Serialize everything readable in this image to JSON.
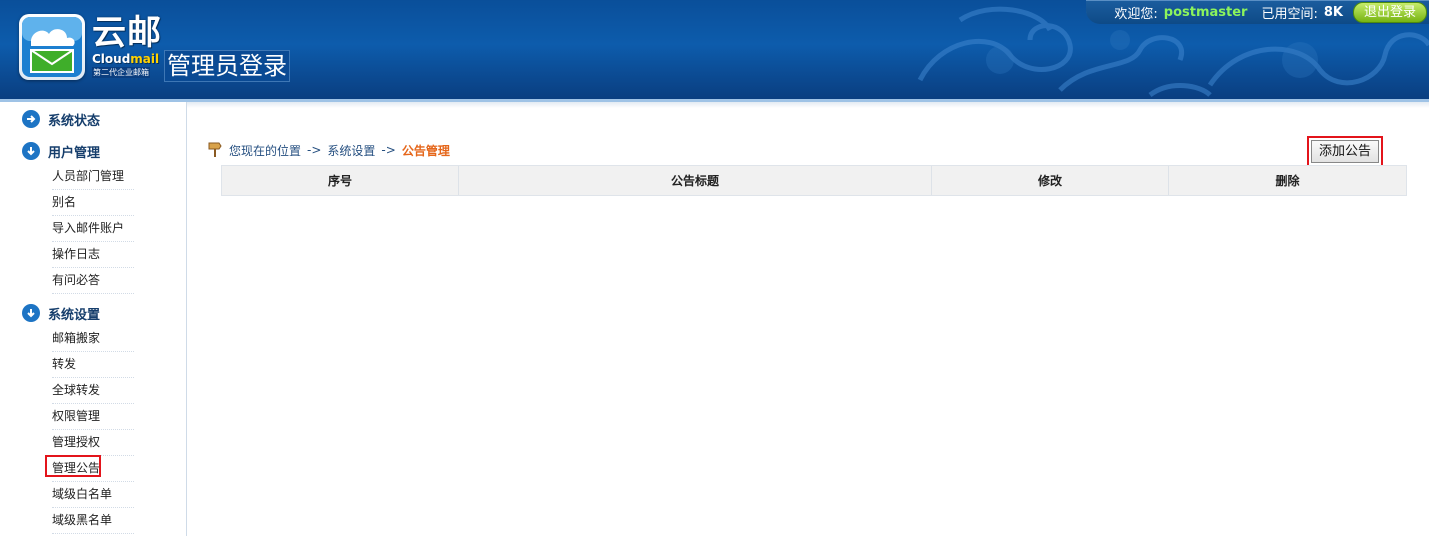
{
  "header": {
    "brand_cn": "云邮",
    "brand_en_1": "Cloud",
    "brand_en_2": "mail",
    "brand_tag": "第二代企业邮箱",
    "login_title": "管理员登录"
  },
  "topbar": {
    "welcome_label": "欢迎您:",
    "username": "postmaster",
    "space_label": "已用空间:",
    "space_value": "8K",
    "logout_label": "退出登录"
  },
  "sidebar": {
    "sections": [
      {
        "label": "系统状态",
        "icon": "arrow-right-circle-icon"
      },
      {
        "label": "用户管理",
        "icon": "arrow-down-circle-icon",
        "items": [
          "人员部门管理",
          "别名",
          "导入邮件账户",
          "操作日志",
          "有问必答"
        ]
      },
      {
        "label": "系统设置",
        "icon": "arrow-down-circle-icon",
        "items": [
          "邮箱搬家",
          "转发",
          "全球转发",
          "权限管理",
          "管理授权",
          "管理公告",
          "域级白名单",
          "域级黑名单"
        ]
      }
    ],
    "active_item": "管理公告"
  },
  "breadcrumb": {
    "prefix": "您现在的位置",
    "separator": "->",
    "level1": "系统设置",
    "current": "公告管理"
  },
  "toolbar": {
    "add_label": "添加公告"
  },
  "table": {
    "columns": [
      "序号",
      "公告标题",
      "修改",
      "删除"
    ],
    "rows": []
  },
  "colors": {
    "header_blue": "#0d5cac",
    "username_green": "#8cf45c",
    "logout_green": "#77b413",
    "highlight_red": "#e3141b",
    "crumb_current": "#e5661a"
  }
}
